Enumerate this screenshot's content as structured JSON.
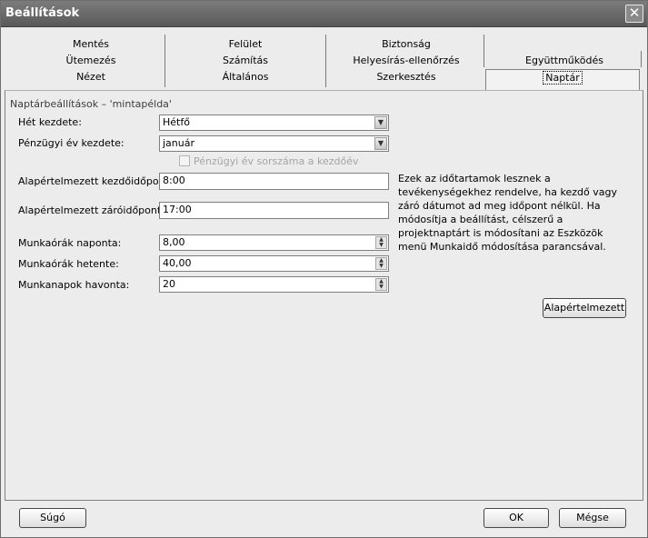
{
  "window": {
    "title": "Beállítások",
    "close_symbol": "✕"
  },
  "tabs": {
    "row1": [
      "Mentés",
      "Felület",
      "Biztonság"
    ],
    "row2": [
      "Ütemezés",
      "Számítás",
      "Helyesírás-ellenőrzés",
      "Együttműködés"
    ],
    "row3": [
      "Nézet",
      "Általános",
      "Szerkesztés",
      "Naptár"
    ],
    "active": "Naptár"
  },
  "section": {
    "label": "Naptárbeállítások – 'mintapélda'"
  },
  "fields": {
    "week_start": {
      "label": "Hét kezdete:",
      "value": "Hétfő"
    },
    "fiscal_year_start": {
      "label": "Pénzügyi év kezdete:",
      "value": "január"
    },
    "fiscal_year_checkbox": {
      "label": "Pénzügyi év sorszáma a kezdőév",
      "checked": false,
      "enabled": false
    },
    "default_start_time": {
      "label": "Alapértelmezett kezdőidőpont:",
      "value": "8:00"
    },
    "default_end_time": {
      "label": "Alapértelmezett záróidőpont:",
      "value": "17:00"
    },
    "hours_per_day": {
      "label": "Munkaórák naponta:",
      "value": "8,00"
    },
    "hours_per_week": {
      "label": "Munkaórák hetente:",
      "value": "40,00"
    },
    "days_per_month": {
      "label": "Munkanapok havonta:",
      "value": "20"
    }
  },
  "info_text": "Ezek az időtartamok lesznek a tevékenységekhez rendelve, ha kezdő vagy záró dátumot ad meg időpont nélkül. Ha módosítja a beállítást, célszerű a projektnaptárt is módosítani az Eszközök menü Munkaidő módosítása parancsával.",
  "buttons": {
    "default": "Alapértelmezett",
    "help": "Súgó",
    "ok": "OK",
    "cancel": "Mégse"
  }
}
